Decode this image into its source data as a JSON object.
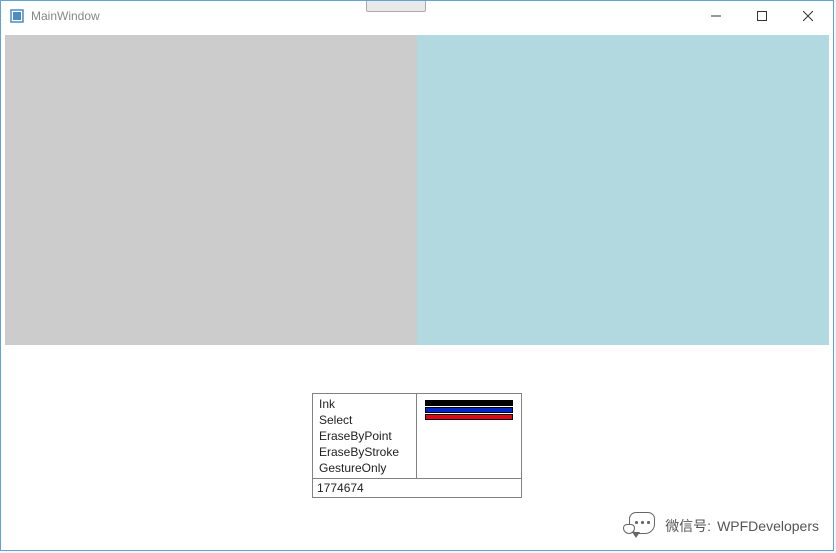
{
  "window": {
    "title": "MainWindow"
  },
  "modes": {
    "items": [
      {
        "label": "Ink"
      },
      {
        "label": "Select"
      },
      {
        "label": "EraseByPoint"
      },
      {
        "label": "EraseByStroke"
      },
      {
        "label": "GestureOnly"
      }
    ]
  },
  "colors": {
    "swatches": [
      {
        "name": "black",
        "hex": "#000000"
      },
      {
        "name": "blue",
        "hex": "#0024c8"
      },
      {
        "name": "red",
        "hex": "#e30613"
      }
    ]
  },
  "status": {
    "value": "1774674"
  },
  "canvas": {
    "left_bg": "#cccccc",
    "right_bg": "#b3d9e0"
  },
  "watermark": {
    "prefix": "微信号:",
    "handle": "WPFDevelopers"
  }
}
